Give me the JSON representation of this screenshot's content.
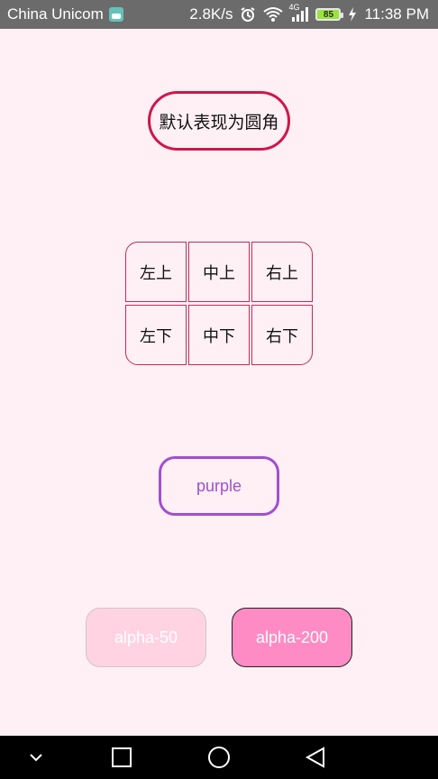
{
  "status_bar": {
    "carrier": "China Unicom",
    "network_speed": "2.8K/s",
    "network_type": "4G",
    "battery_level": "85",
    "time": "11:38 PM",
    "icons": [
      "android-notification-icon",
      "alarm-icon",
      "wifi-icon",
      "signal-icon",
      "battery-icon",
      "charging-icon"
    ]
  },
  "buttons": {
    "rounded_default": "默认表现为圆角",
    "grid": [
      "左上",
      "中上",
      "右上",
      "左下",
      "中下",
      "右下"
    ],
    "purple": "purple",
    "alpha_50": "alpha-50",
    "alpha_200": "alpha-200"
  },
  "nav_bar": {
    "icons": [
      "collapse-icon",
      "recents-icon",
      "home-icon",
      "back-icon"
    ]
  },
  "colors": {
    "background": "#fff0f5",
    "status_bar": "#6b6b6b",
    "rounded_border": "#d1154a",
    "grid_border": "#c42a52",
    "purple": "#a24fcf",
    "alpha_50_fill": "#ffd3e1",
    "alpha_200_fill": "#ff8bc4"
  }
}
